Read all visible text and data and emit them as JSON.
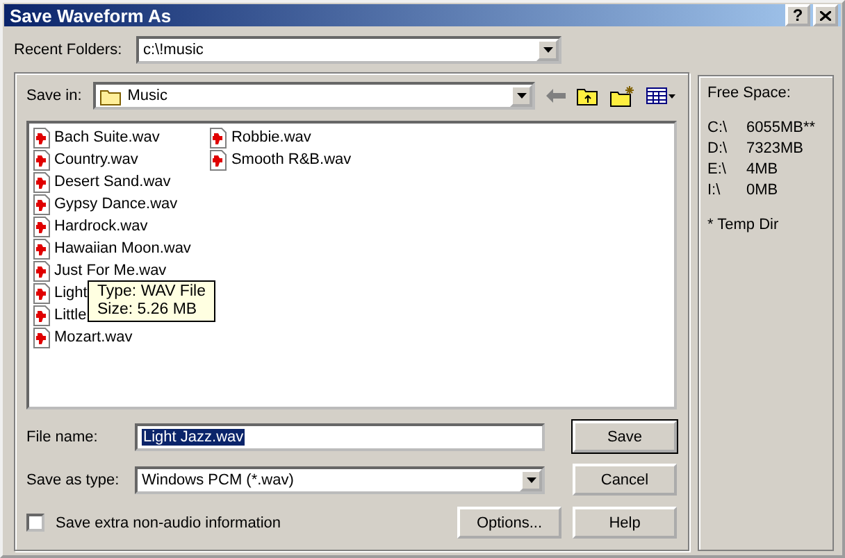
{
  "window": {
    "title": "Save Waveform As",
    "help_button": "?"
  },
  "recent_folders": {
    "label": "Recent Folders:",
    "value": "c:\\!music"
  },
  "save_in": {
    "label": "Save in:",
    "value": "Music"
  },
  "files": [
    {
      "name": "Bach Suite.wav"
    },
    {
      "name": "Country.wav"
    },
    {
      "name": "Desert Sand.wav"
    },
    {
      "name": "Gypsy Dance.wav"
    },
    {
      "name": "Hardrock.wav"
    },
    {
      "name": "Hawaiian Moon.wav"
    },
    {
      "name": "Just For Me.wav"
    },
    {
      "name": "Light"
    },
    {
      "name": "Little"
    },
    {
      "name": "Mozart.wav"
    },
    {
      "name": "Robbie.wav"
    },
    {
      "name": "Smooth R&B.wav"
    }
  ],
  "tooltip": {
    "lines": [
      "Type: WAV File",
      "Size: 5.26 MB"
    ]
  },
  "file_name": {
    "label": "File name:",
    "value": "Light Jazz.wav"
  },
  "save_as_type": {
    "label": "Save as type:",
    "value": "Windows PCM (*.wav)"
  },
  "extra_info": {
    "label": "Save extra non-audio information",
    "checked": false
  },
  "buttons": {
    "save": "Save",
    "cancel": "Cancel",
    "options": "Options...",
    "help": "Help"
  },
  "free_space": {
    "title": "Free Space:",
    "drives": [
      {
        "drive": "C:\\",
        "space": "6055MB**"
      },
      {
        "drive": "D:\\",
        "space": "7323MB"
      },
      {
        "drive": "E:\\",
        "space": "4MB"
      },
      {
        "drive": "I:\\",
        "space": "0MB"
      }
    ],
    "note": "* Temp Dir"
  }
}
